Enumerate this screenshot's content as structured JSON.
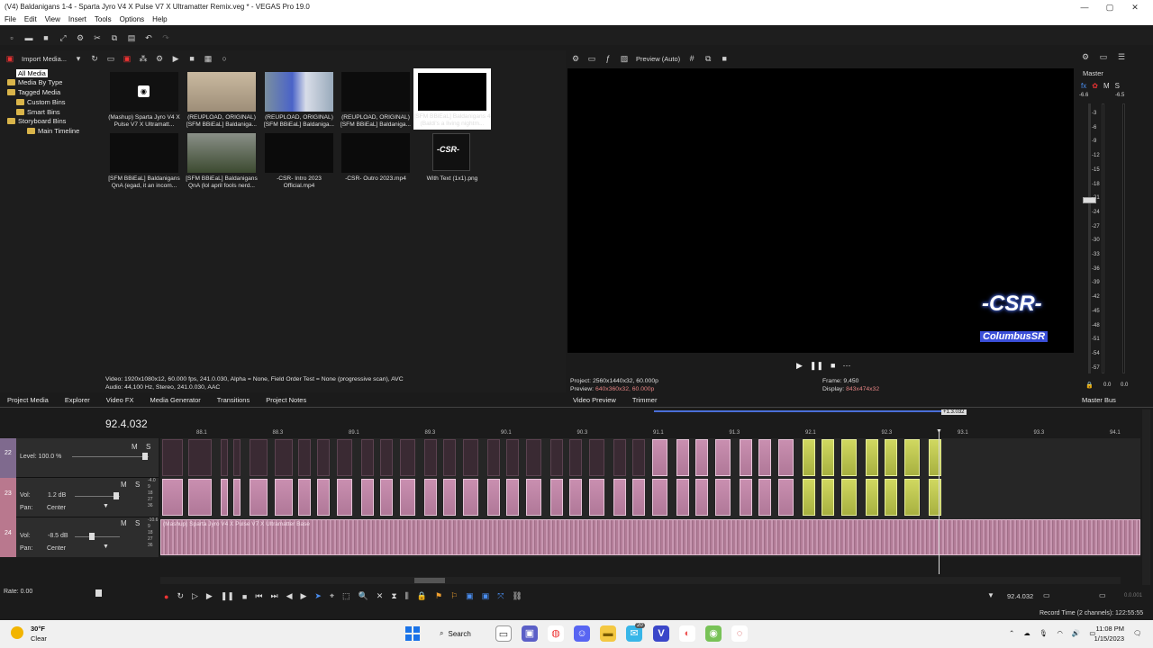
{
  "window": {
    "title": "(V4) Baldanigans 1-4 - Sparta Jyro V4 X Pulse V7 X Ultramatter Remix.veg * - VEGAS Pro 19.0",
    "minimize": "—",
    "maximize": "▢",
    "close": "✕"
  },
  "menu": [
    "File",
    "Edit",
    "View",
    "Insert",
    "Tools",
    "Options",
    "Help"
  ],
  "media_panel": {
    "import_label": "Import Media...",
    "tree": [
      {
        "label": "All Media"
      },
      {
        "label": "Media By Type"
      },
      {
        "label": "Tagged Media"
      },
      {
        "label": "Custom Bins"
      },
      {
        "label": "Smart Bins"
      },
      {
        "label": "Storyboard Bins"
      },
      {
        "label": "Main Timeline"
      }
    ],
    "items": [
      {
        "cap": "(Mashup) Sparta Jyro V4 X Pulse V7 X Ultramatt..."
      },
      {
        "cap": "(REUPLOAD, ORIGINAL) [SFM BBiEaL] Baldaniga..."
      },
      {
        "cap": "(REUPLOAD, ORIGINAL) [SFM BBiEaL] Baldaniga..."
      },
      {
        "cap": "(REUPLOAD, ORIGINAL) [SFM BBiEaL] Baldaniga..."
      },
      {
        "cap": "[SFM BBiEaL] Baldanigans 4 (Baldi's a living nightm..."
      },
      {
        "cap": "[SFM BBiEaL] Baldanigans QnA (egad, it an incom..."
      },
      {
        "cap": "[SFM BBiEaL] Baldanigans QnA (lol april fools nerd..."
      },
      {
        "cap": "-CSR- Intro 2023 Official.mp4"
      },
      {
        "cap": "-CSR- Outro 2023.mp4"
      },
      {
        "cap": "With Text (1x1).png"
      }
    ],
    "info_line1": "Video: 1920x1080x12, 60.000 fps, 241.0.030, Alpha = None, Field Order Test = None (progressive scan), AVC",
    "info_line2": "Audio: 44,100 Hz, Stereo, 241.0.030, AAC"
  },
  "left_tabs": [
    "Project Media",
    "Explorer",
    "Video FX",
    "Media Generator",
    "Transitions",
    "Project Notes"
  ],
  "preview": {
    "mode": "Preview (Auto)",
    "logo_text": "-CSR-",
    "logo_sub": "ColumbusSR",
    "project_label": "Project:",
    "project_value": "2560x1440x32, 60.000p",
    "preview_label": "Preview:",
    "preview_value": "640x360x32, 60.000p",
    "frame_label": "Frame:",
    "frame_value": "9,450",
    "display_label": "Display:",
    "display_value": "843x474x32",
    "tabs": [
      "Video Preview",
      "Trimmer"
    ]
  },
  "master": {
    "title": "Master",
    "m": "M",
    "s": "S",
    "top_left": "-6.6",
    "top_right": "-6.5",
    "scale": [
      "3",
      "6",
      "9",
      "12",
      "15",
      "18",
      "21",
      "24",
      "27",
      "30",
      "33",
      "36",
      "39",
      "42",
      "45",
      "48",
      "51",
      "54",
      "57"
    ],
    "bottom_left": "0.0",
    "bottom_right": "0.0",
    "tab": "Master Bus"
  },
  "timeline": {
    "time": "92.4.032",
    "marker_time": "+1.3.032",
    "ruler": [
      "88.1",
      "88.3",
      "89.1",
      "89.3",
      "90.1",
      "90.3",
      "91.1",
      "91.3",
      "92.1",
      "92.3",
      "93.1",
      "93.3",
      "94.1"
    ],
    "tracks": [
      {
        "num": "22",
        "label1": "Level: 100.0 %",
        "label2": ""
      },
      {
        "num": "23",
        "label1": "Vol:",
        "val1": "1.2 dB",
        "label2": "Pan:",
        "val2": "Center"
      },
      {
        "num": "24",
        "label1": "Vol:",
        "val1": "-8.5 dB",
        "label2": "Pan:",
        "val2": "Center"
      }
    ],
    "audio_clip_label": "(Mashup) Sparta Jyro V4 X Pulse V7 X Ultramatter Base",
    "rate": "Rate: 0.00",
    "cursor_time": "92.4.032",
    "record_time": "Record Time (2 channels): 122:55:55",
    "right_time": "0.0.001"
  },
  "taskbar": {
    "weather_temp": "30°F",
    "weather_desc": "Clear",
    "search": "Search",
    "badge": "20",
    "time": "11:08 PM",
    "date": "1/15/2023"
  },
  "colors": {
    "accent": "#4a6fd8",
    "pink_clip": "#c98fb0",
    "yellow_clip": "#c9d35a"
  }
}
